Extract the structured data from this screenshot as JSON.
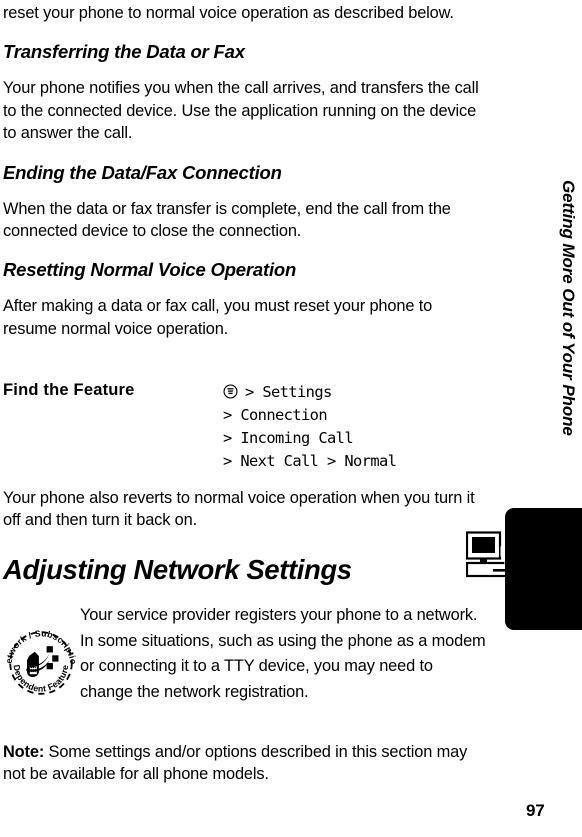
{
  "page": {
    "number": "97",
    "running_head": "Getting More Out of Your Phone"
  },
  "blocks": {
    "intro_continued": "reset your phone to normal voice operation as described below.",
    "heading_transferring": "Transferring the Data or Fax",
    "para_transferring": "Your phone notifies you when the call arrives, and transfers the call to the connected device. Use the application running on the device to answer the call.",
    "heading_ending": "Ending the Data/Fax Connection",
    "para_ending": "When the data or fax transfer is complete, end the call from the connected device to close the connection.",
    "heading_resetting": "Resetting Normal Voice Operation",
    "para_resetting": "After making a data or fax call, you must reset your phone to resume normal voice operation.",
    "para_reverts": "Your phone also reverts to normal voice operation when you turn it off and then turn it back on.",
    "heading_adjusting": "Adjusting Network Settings",
    "para_service_provider": "Your service provider registers your phone to a network. In some situations, such as using the phone as a modem or connecting it to a TTY device, you may need to change the network registration.",
    "note_lead": "Note:",
    "note_text": " Some settings and/or options described in this section may not be available for all phone models."
  },
  "find_the_feature": {
    "label": "Find the Feature",
    "menu_key_icon": "menu-key-icon",
    "path_lines": [
      "> Settings",
      "> Connection",
      "> Incoming Call",
      "> Next Call > Normal"
    ]
  },
  "icons": {
    "device_icon": "computer-and-handset-icon",
    "badge_icon": "network-subscription-dependent-feature-badge",
    "badge_text_top": "Network / Subscription",
    "badge_text_bottom": "Dependent Feature"
  },
  "colors": {
    "ink": "#000000",
    "paper": "#ffffff",
    "tab": "#000000"
  }
}
